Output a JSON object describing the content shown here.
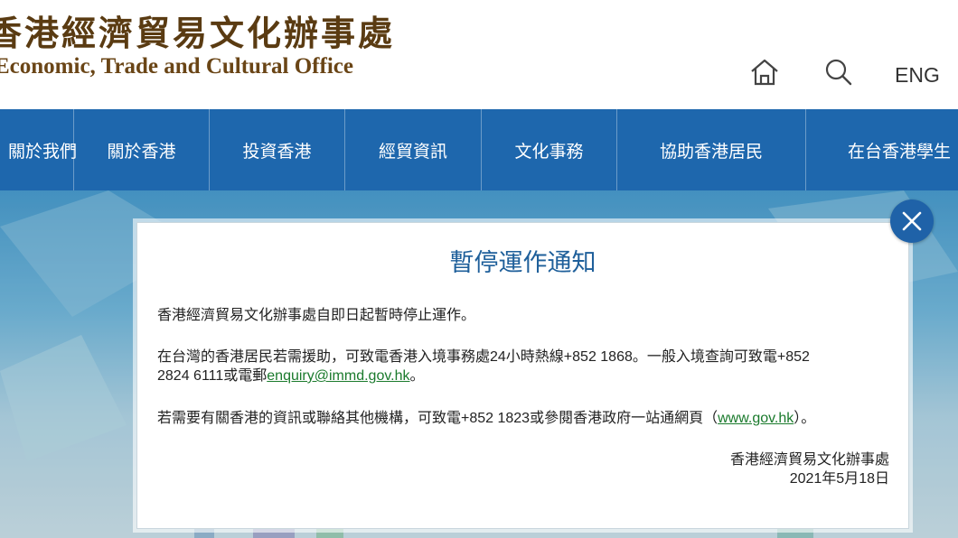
{
  "header": {
    "logo_cn": "香港經濟貿易文化辦事處",
    "logo_en": "Economic, Trade and Cultural Office",
    "lang_label": "ENG"
  },
  "nav": {
    "items": [
      {
        "label": "關於我們"
      },
      {
        "label": "關於香港"
      },
      {
        "label": "投資香港"
      },
      {
        "label": "經貿資訊"
      },
      {
        "label": "文化事務"
      },
      {
        "label": "協助香港居民"
      },
      {
        "label": "在台香港學生"
      }
    ]
  },
  "modal": {
    "title": "暫停運作通知",
    "p1": "香港經濟貿易文化辦事處自即日起暫時停止運作。",
    "p2_line1": "在台灣的香港居民若需援助，可致電香港入境事務處24小時熱線+852 1868。一般入境查詢可致電+852",
    "p2_line2_pre": "2824 6111或電郵",
    "p2_email": "enquiry@immd.gov.hk",
    "p2_line2_post": "。",
    "p3_pre": "若需要有關香港的資訊或聯絡其他機構，可致電+852 1823或參閱香港政府一站通網頁（",
    "p3_link": "www.gov.hk",
    "p3_post": "）。",
    "signature": "香港經濟貿易文化辦事處",
    "date": "2021年5月18日"
  },
  "icons": {
    "home": "home-icon",
    "search": "search-icon",
    "close": "close-icon"
  },
  "colors": {
    "nav_bg": "#1e67ad",
    "title": "#1e5f9a",
    "link": "#1a7a2c",
    "logo": "#5a3b12",
    "close_bg": "#1f62a8"
  }
}
